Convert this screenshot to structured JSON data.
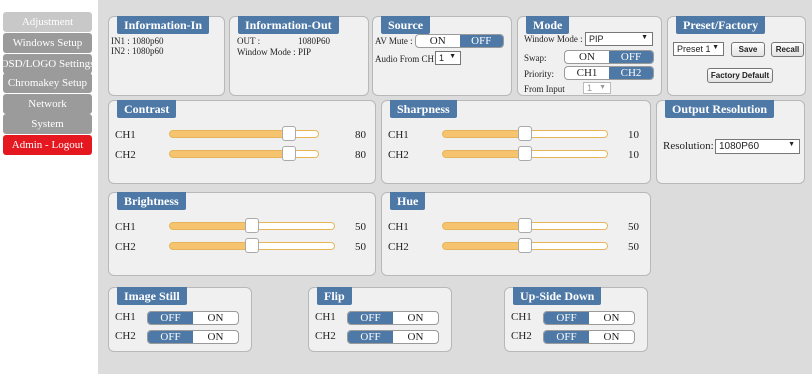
{
  "sidebar": {
    "items": [
      {
        "label": "Adjustment",
        "active": true
      },
      {
        "label": "Windows Setup"
      },
      {
        "label": "OSD/LOGO Settings"
      },
      {
        "label": "Chromakey Setup"
      },
      {
        "label": "Network"
      },
      {
        "label": "System"
      },
      {
        "label": "Admin - Logout"
      }
    ]
  },
  "info_in": {
    "title": "Information-In",
    "in1": "IN1 : 1080p60",
    "in2": "IN2 : 1080p60"
  },
  "info_out": {
    "title": "Information-Out",
    "out_label": "OUT :",
    "out_value": "1080P60",
    "mode_label": "Window Mode :",
    "mode_value": "PIP"
  },
  "source": {
    "title": "Source",
    "av_mute_label": "AV Mute :",
    "on": "ON",
    "off": "OFF",
    "av_mute_state": "OFF",
    "audio_label": "Audio From CH",
    "audio_value": "1"
  },
  "mode": {
    "title": "Mode",
    "window_mode_label": "Window Mode :",
    "window_mode_value": "PIP",
    "swap_label": "Swap:",
    "swap_on": "ON",
    "swap_off": "OFF",
    "swap_state": "OFF",
    "priority_label": "Priority:",
    "priority_ch1": "CH1",
    "priority_ch2": "CH2",
    "priority_state": "CH2",
    "from_input_label": "From Input",
    "from_input_value": "1"
  },
  "preset": {
    "title": "Preset/Factory",
    "preset_value": "Preset 1",
    "save_label": "Save",
    "recall_label": "Recall",
    "factory_label": "Factory Default"
  },
  "contrast": {
    "title": "Contrast",
    "ch1_label": "CH1",
    "ch1_value": "80",
    "ch2_label": "CH2",
    "ch2_value": "80",
    "max": 100
  },
  "sharpness": {
    "title": "Sharpness",
    "ch1_label": "CH1",
    "ch1_value": "10",
    "ch2_label": "CH2",
    "ch2_value": "10",
    "max": 20
  },
  "output": {
    "title": "Output Resolution",
    "resolution_label": "Resolution:",
    "resolution_value": "1080P60"
  },
  "brightness": {
    "title": "Brightness",
    "ch1_label": "CH1",
    "ch1_value": "50",
    "ch2_label": "CH2",
    "ch2_value": "50",
    "max": 100
  },
  "hue": {
    "title": "Hue",
    "ch1_label": "CH1",
    "ch1_value": "50",
    "ch2_label": "CH2",
    "ch2_value": "50",
    "max": 100
  },
  "image_still": {
    "title": "Image Still",
    "ch1_label": "CH1",
    "ch2_label": "CH2",
    "off": "OFF",
    "on": "ON",
    "ch1_state": "OFF",
    "ch2_state": "OFF"
  },
  "flip": {
    "title": "Flip",
    "ch1_label": "CH1",
    "ch2_label": "CH2",
    "off": "OFF",
    "on": "ON",
    "ch1_state": "OFF",
    "ch2_state": "OFF"
  },
  "upside_down": {
    "title": "Up-Side Down",
    "ch1_label": "CH1",
    "ch2_label": "CH2",
    "off": "OFF",
    "on": "ON",
    "ch1_state": "OFF",
    "ch2_state": "OFF"
  },
  "colors": {
    "accent": "#4e79a7",
    "slider_fill": "#f6c46e",
    "logout": "#e5171f",
    "sidebar_item": "#9b9b9b"
  }
}
